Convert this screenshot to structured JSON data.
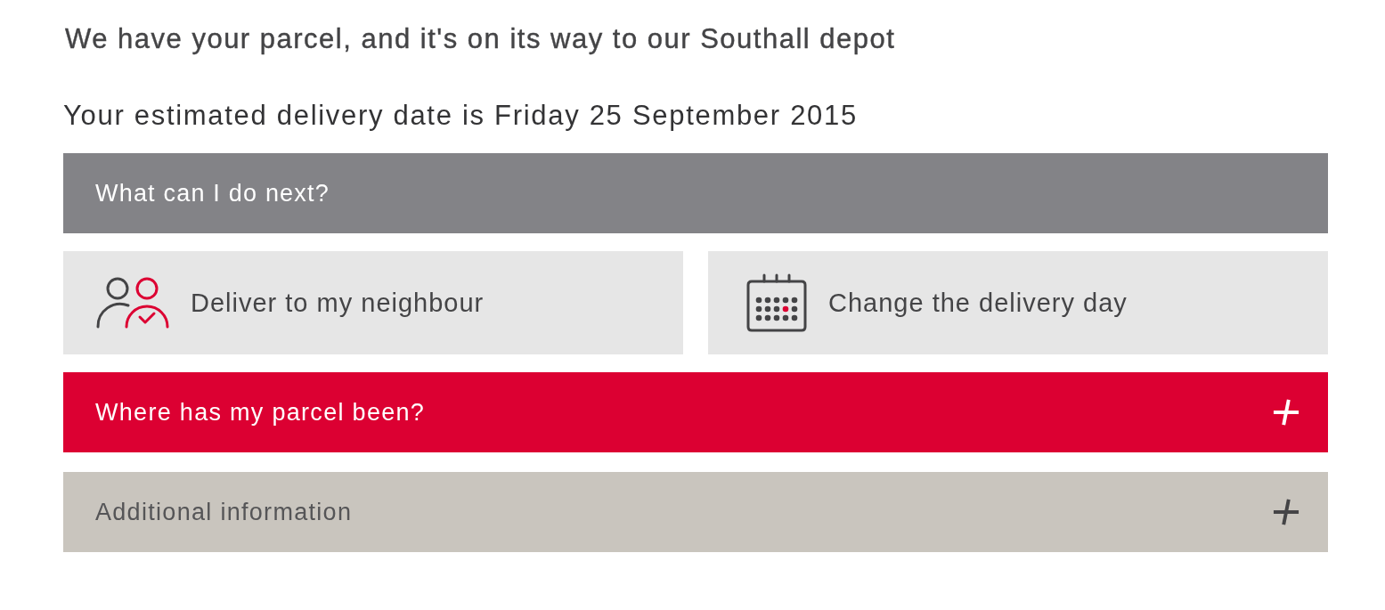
{
  "status": {
    "heading": "We have your parcel, and it's on its way to our Southall depot",
    "estimate": "Your estimated delivery date is Friday 25 September 2015"
  },
  "next_steps": {
    "title": "What can I do next?",
    "actions": [
      {
        "label": "Deliver to my neighbour",
        "kind": "neighbour"
      },
      {
        "label": "Change the delivery day",
        "kind": "calendar"
      }
    ]
  },
  "sections": [
    {
      "title": "Where has my parcel been?",
      "kind": "primary",
      "expanded": false
    },
    {
      "title": "Additional information",
      "kind": "secondary",
      "expanded": false
    }
  ]
}
